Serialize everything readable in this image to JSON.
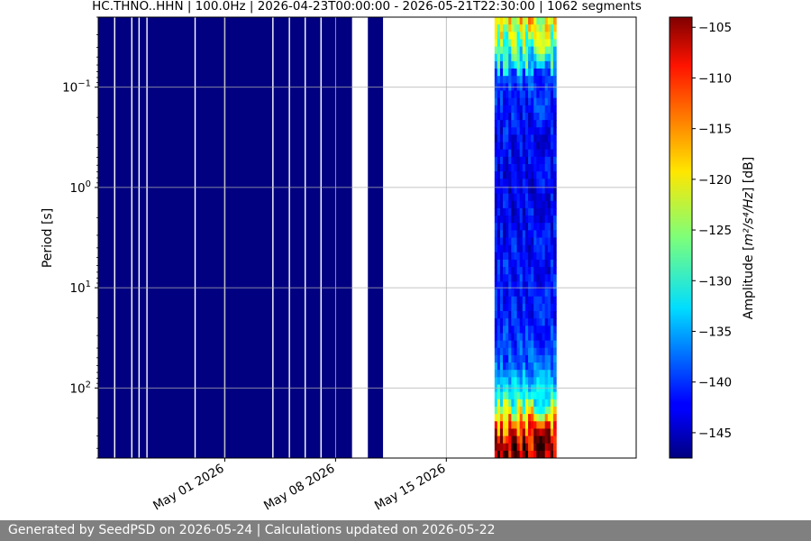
{
  "chart_data": {
    "type": "heatmap",
    "title": "HC.THNO..HHN | 100.0Hz | 2026-04-23T00:00:00 - 2026-05-21T22:30:00 | 1062 segments",
    "ylabel": "Period [s]",
    "yscale": "log",
    "ylim": [
      0.02,
      500
    ],
    "y_inverted": true,
    "x_range": [
      "2026-04-23",
      "2026-05-27"
    ],
    "x_ticks": [
      {
        "date": "2026-05-01",
        "label": "May 01 2026"
      },
      {
        "date": "2026-05-08",
        "label": "May 08 2026"
      },
      {
        "date": "2026-05-15",
        "label": "May 15 2026"
      }
    ],
    "y_ticks": [
      {
        "value": 0.1,
        "base": "10",
        "exp": "−1"
      },
      {
        "value": 1,
        "base": "10",
        "exp": "0"
      },
      {
        "value": 10,
        "base": "10",
        "exp": "1"
      },
      {
        "value": 100,
        "base": "10",
        "exp": "2"
      }
    ],
    "grid": true,
    "colormap": "jet",
    "colorbar": {
      "label_prefix": "Amplitude [",
      "label_unit": "m²/s⁴/Hz",
      "label_suffix": "] [dB]",
      "vmin": -147.5,
      "vmax": -104,
      "ticks": [
        -105,
        -110,
        -115,
        -120,
        -125,
        -130,
        -135,
        -140,
        -145
      ],
      "tick_labels": [
        "−105",
        "−110",
        "−115",
        "−120",
        "−125",
        "−130",
        "−135",
        "−140",
        "−145"
      ]
    },
    "low_level_dates": [
      "2026-04-23",
      "2026-05-11"
    ],
    "gaps": [
      [
        "2026-05-09T01:00",
        "2026-05-10T01:00"
      ],
      [
        "2026-05-12T04:00",
        "2026-05-13T01:00"
      ],
      [
        "2026-05-14T01:00",
        "2026-05-17T02:00"
      ]
    ],
    "blank_lines": [
      "2026-04-24T00:00",
      "2026-04-25T02:00",
      "2026-04-25T13:00",
      "2026-04-26T01:00",
      "2026-04-29T02:00",
      "2026-04-30T23:00",
      "2026-05-04T00:00",
      "2026-05-05T01:00",
      "2026-05-06T01:00",
      "2026-05-07T01:00"
    ],
    "active_range": [
      "2026-05-18T01:00",
      "2026-05-21T22:30"
    ],
    "active_profile": [
      {
        "period": 0.02,
        "db": -120
      },
      {
        "period": 0.06,
        "db": -132
      },
      {
        "period": 0.09,
        "db": -140
      },
      {
        "period": 0.3,
        "db": -142
      },
      {
        "period": 1,
        "db": -143
      },
      {
        "period": 4,
        "db": -142
      },
      {
        "period": 20,
        "db": -141
      },
      {
        "period": 60,
        "db": -138
      },
      {
        "period": 120,
        "db": -130
      },
      {
        "period": 180,
        "db": -122
      },
      {
        "period": 250,
        "db": -112
      },
      {
        "period": 400,
        "db": -105
      }
    ]
  },
  "footer": {
    "text": "Generated by SeedPSD on 2026-05-24 | Calculations updated on 2026-05-22"
  }
}
